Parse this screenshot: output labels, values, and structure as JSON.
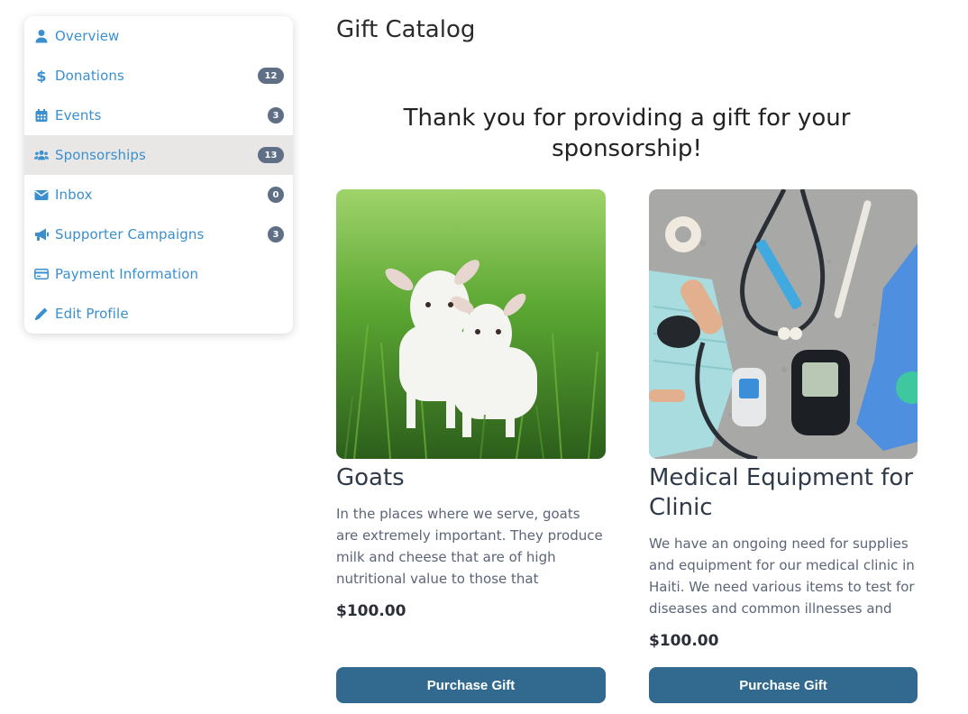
{
  "sidebar": {
    "items": [
      {
        "label": "Overview",
        "icon": "user-icon",
        "badge": null,
        "active": false
      },
      {
        "label": "Donations",
        "icon": "dollar-icon",
        "badge": "12",
        "active": false
      },
      {
        "label": "Events",
        "icon": "calendar-icon",
        "badge": "3",
        "active": false
      },
      {
        "label": "Sponsorships",
        "icon": "users-icon",
        "badge": "13",
        "active": true
      },
      {
        "label": "Inbox",
        "icon": "envelope-icon",
        "badge": "0",
        "active": false
      },
      {
        "label": "Supporter Campaigns",
        "icon": "megaphone-icon",
        "badge": "3",
        "active": false
      },
      {
        "label": "Payment Information",
        "icon": "credit-card-icon",
        "badge": null,
        "active": false
      },
      {
        "label": "Edit Profile",
        "icon": "pencil-icon",
        "badge": null,
        "active": false
      }
    ]
  },
  "main": {
    "title": "Gift Catalog",
    "thanks": "Thank you for providing a gift for your sponsorship!",
    "cards": [
      {
        "title": "Goats",
        "image": "two white goats in green grass",
        "description": "In the places where we serve, goats are extremely important. They produce milk and cheese that are of high nutritional value to those that",
        "price": "$100.00",
        "button": "Purchase Gift"
      },
      {
        "title": "Medical Equipment for Clinic",
        "image": "medical supplies on concrete surface",
        "description": "We have an ongoing need for supplies and equipment for our medical clinic in Haiti. We need various items to test for diseases and common illnesses and",
        "price": "$100.00",
        "button": "Purchase Gift"
      }
    ]
  },
  "colors": {
    "accent": "#3a8fcf",
    "badge": "#5f6f86",
    "button": "#326a8f",
    "active_row": "#e8e7e6"
  }
}
